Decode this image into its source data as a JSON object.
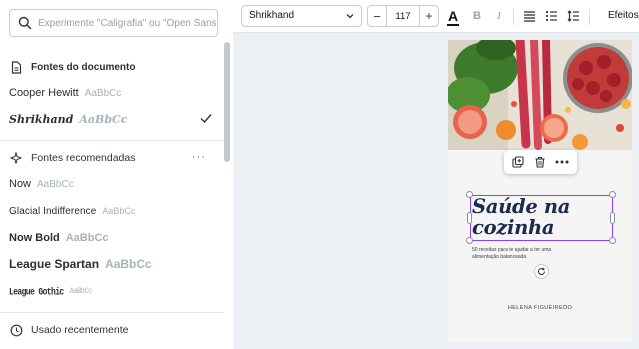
{
  "font_panel": {
    "search": {
      "placeholder": "Experimente \"Caligrafia\" ou \"Open Sans\"",
      "value": ""
    },
    "document_fonts": {
      "heading": "Fontes do documento",
      "items": [
        {
          "name": "Cooper Hewitt",
          "sample": "AaBbCc",
          "selected": false
        },
        {
          "name": "Shrikhand",
          "sample": "AaBbCc",
          "selected": true
        }
      ]
    },
    "recommended_fonts": {
      "heading": "Fontes recomendadas",
      "more": "···",
      "items": [
        {
          "name": "Now",
          "sample": "AaBbCc"
        },
        {
          "name": "Glacial Indifference",
          "sample": "AaBbCc"
        },
        {
          "name": "Now Bold",
          "sample": "AaBbCc"
        },
        {
          "name": "League Spartan",
          "sample": "AaBbCc"
        },
        {
          "name": "League Gothic",
          "sample": "AaBbCc"
        }
      ]
    },
    "recently_used": {
      "heading": "Usado recentemente"
    }
  },
  "toolbar": {
    "font_name": "Shrikhand",
    "font_size": "117",
    "minus": "−",
    "plus": "+",
    "text_color_label": "A",
    "bold_label": "B",
    "italic_label": "I",
    "effects_label": "Efeitos",
    "icons": [
      "text-color-icon",
      "align-icon",
      "list-icon",
      "spacing-icon"
    ]
  },
  "canvas": {
    "title_line1": "Saúde na",
    "title_line2": "cozinha",
    "subtitle": "50 receitas para te ajudar a ter uma alimentação balanceada",
    "author": "HELENA FIGUEIREDO",
    "colors": {
      "selection": "#8b3dff",
      "title": "#1d2a4e"
    }
  }
}
